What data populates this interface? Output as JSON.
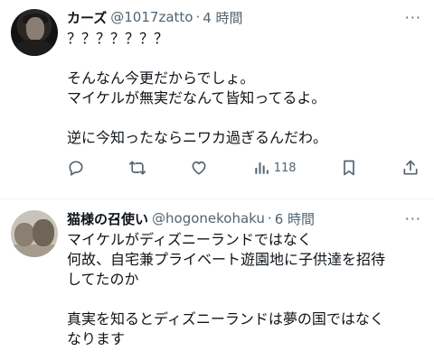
{
  "tweets": [
    {
      "display_name": "カーズ",
      "handle": "@1017zatto",
      "separator": "·",
      "time": "4 時間",
      "more": "···",
      "lines": [
        "？？？？？？？",
        "",
        "そんなん今更だからでしょ。",
        "マイケルが無実だなんて皆知ってるよ。",
        "",
        "逆に今知ったならニワカ過ぎるんだわ。"
      ],
      "views": "118"
    },
    {
      "display_name": "猫様の召使い",
      "handle": "@hogonekohaku",
      "separator": "·",
      "time": "6 時間",
      "more": "···",
      "lines": [
        "マイケルがディズニーランドではなく",
        "何故、自宅兼プライベート遊園地に子供達を招待",
        "してたのか",
        "",
        "真実を知るとディズニーランドは夢の国ではなく",
        "なります"
      ]
    }
  ],
  "icons": [
    "reply-icon",
    "retweet-icon",
    "like-icon",
    "views-icon",
    "bookmark-icon",
    "share-icon"
  ],
  "colors": {
    "text": "#0f1419",
    "secondary": "#536471",
    "divider": "#eff3f4"
  }
}
